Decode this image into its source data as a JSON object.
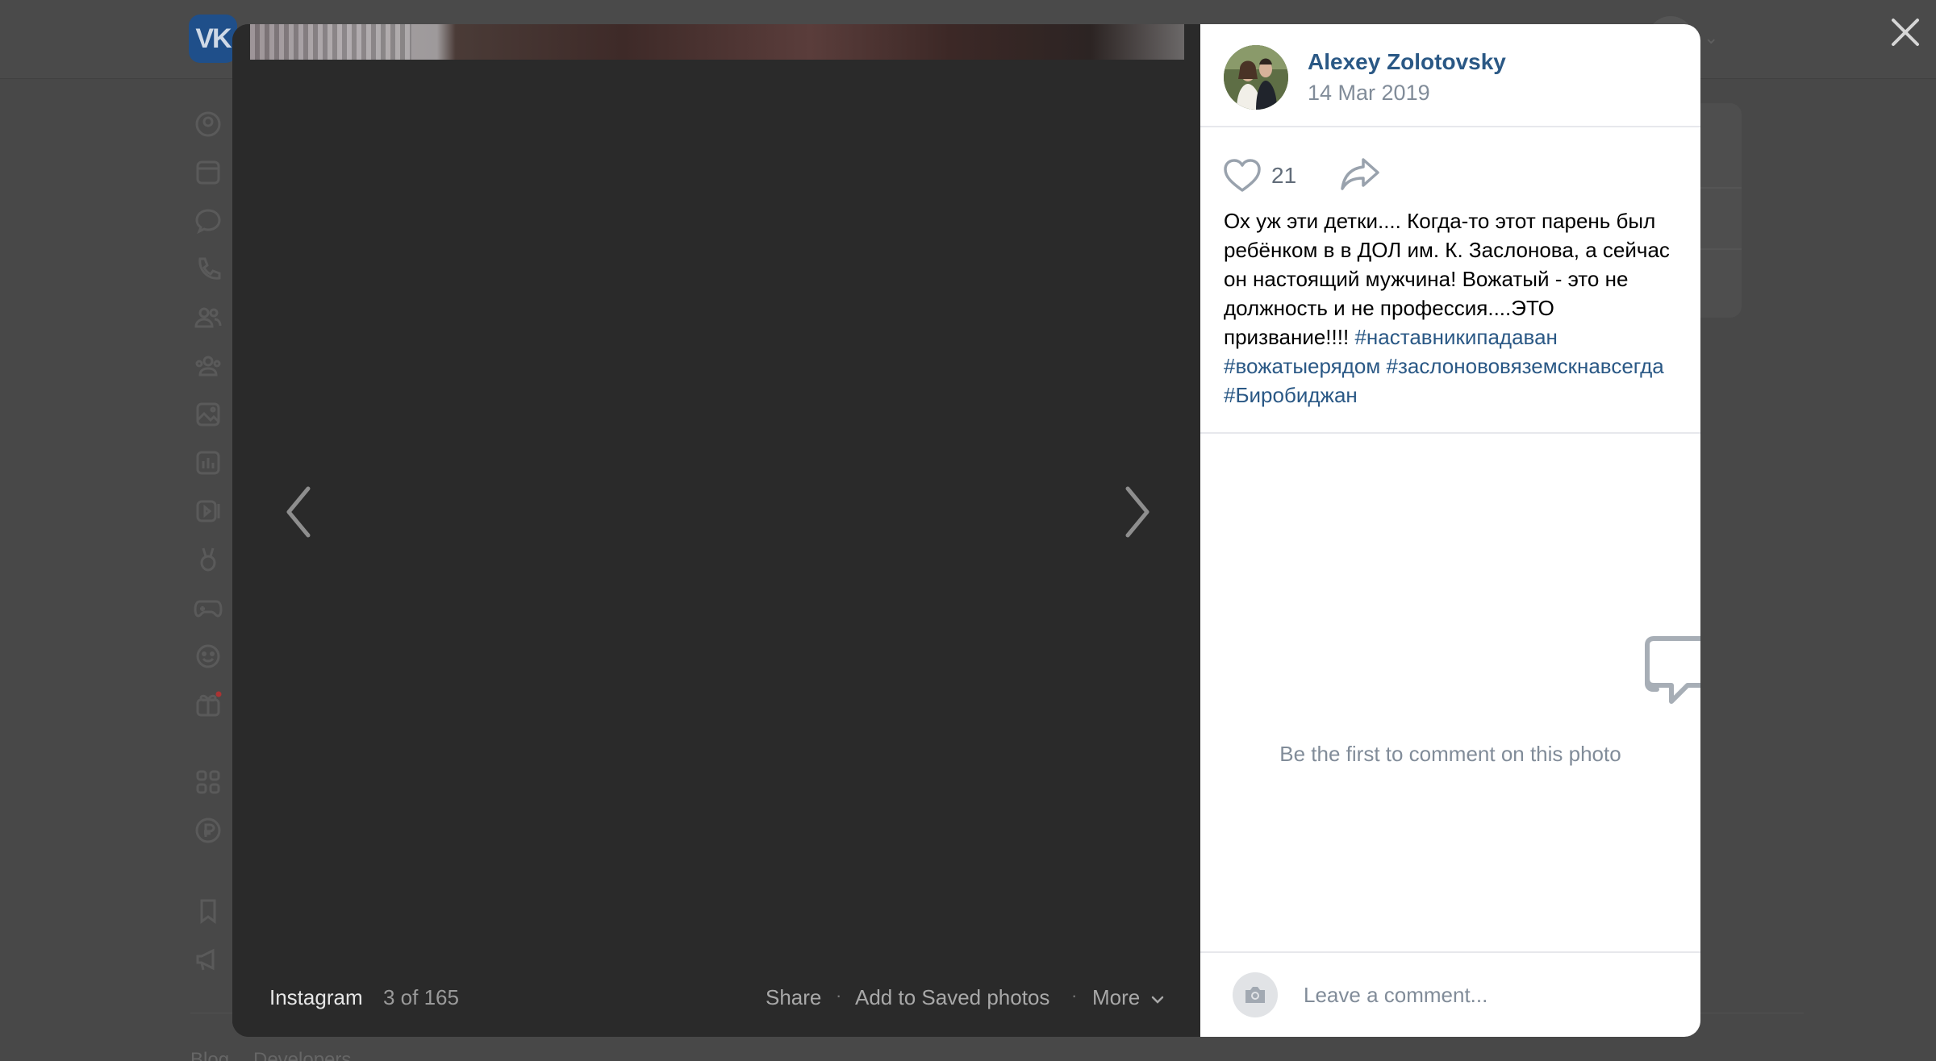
{
  "background": {
    "logo_text": "VK",
    "footer_links": [
      "Blog",
      "Developers"
    ],
    "sidebar_icons": [
      "profile-icon",
      "news-icon",
      "messages-icon",
      "calls-icon",
      "friends-icon",
      "communities-icon",
      "photos-icon",
      "music-icon",
      "videos-icon",
      "clips-icon",
      "games-icon",
      "stickers-icon",
      "gifts-icon",
      "mini-apps-icon",
      "payments-icon",
      "bookmarks-icon",
      "ads-icon"
    ]
  },
  "viewer": {
    "source_label": "Instagram",
    "counter": "3 of 165",
    "actions": {
      "share": "Share",
      "separator": "·",
      "save": "Add to Saved photos",
      "more": "More"
    }
  },
  "post": {
    "author_name": "Alexey Zolotovsky",
    "date": "14 Mar 2019",
    "likes": "21",
    "caption_text": "Ох уж эти детки.... Когда-то этот парень был ребёнком в в ДОЛ им. К. Заслонова, а сейчас он настоящий мужчина! Вожатый - это не должность и не профессия....ЭТО призвание!!!! ",
    "hashtags": [
      "#наставникипадаван",
      "#вожатыерядом",
      "#заслонововяземскнавсегда",
      "#Биробиджан"
    ]
  },
  "comments": {
    "empty_text": "Be the first to comment on this photo",
    "input_placeholder": "Leave a comment..."
  },
  "colors": {
    "link": "#2a5885",
    "muted": "#818c99",
    "viewer_bg": "#282828"
  }
}
